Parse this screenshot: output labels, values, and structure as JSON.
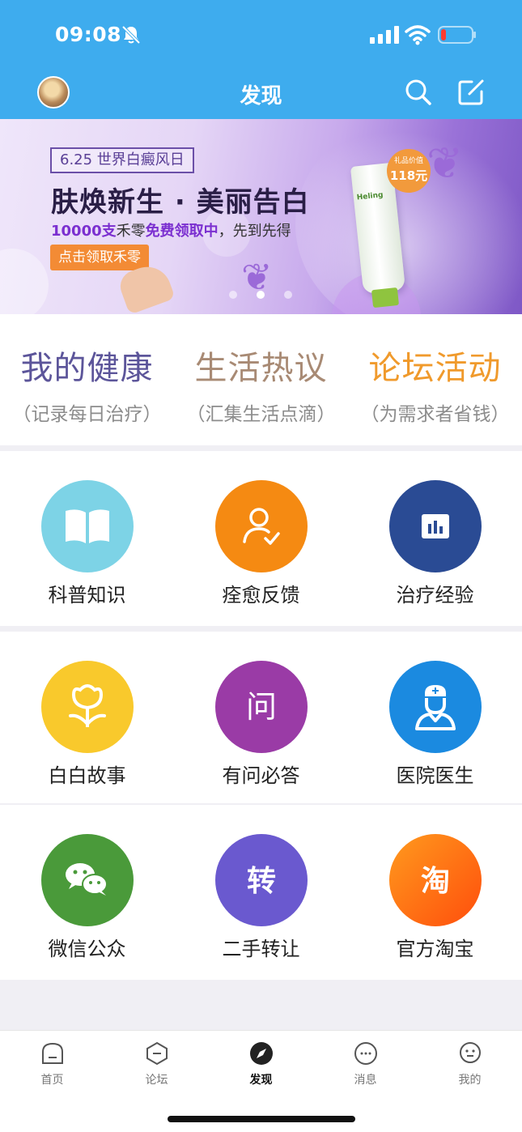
{
  "status_bar": {
    "time": "09:08",
    "icons": [
      "bell-mute-icon",
      "signal-icon",
      "wifi-icon",
      "battery-low-icon"
    ]
  },
  "header": {
    "title": "发现",
    "avatar": "user-avatar",
    "actions": [
      "search-icon",
      "edit-icon"
    ]
  },
  "banner": {
    "tag": "6.25 世界白癜风日",
    "headline": "肤焕新生 · 美丽告白",
    "subline_qty": "10000支",
    "subline_mid": "禾零",
    "subline_hl": "免费领取中",
    "subline_tail": "，先到先得",
    "cta": "点击领取禾零",
    "product_label": "Heling",
    "price_badge_top": "礼品价值",
    "price_badge_value": "118元",
    "carousel": {
      "count": 3,
      "active": 2
    }
  },
  "sections": [
    {
      "title": "我的健康",
      "desc": "（记录每日治疗）",
      "color": "#5c559a"
    },
    {
      "title": "生活热议",
      "desc": "（汇集生活点滴）",
      "color": "#a88a74"
    },
    {
      "title": "论坛活动",
      "desc": "（为需求者省钱）",
      "color": "#f09a2c"
    }
  ],
  "features": [
    [
      {
        "label": "科普知识",
        "icon": "book-icon",
        "color": "#7dd3e6"
      },
      {
        "label": "痊愈反馈",
        "icon": "user-check-icon",
        "color": "#f58a12"
      },
      {
        "label": "治疗经验",
        "icon": "chart-icon",
        "color": "#2a4b94"
      }
    ],
    [
      {
        "label": "白白故事",
        "icon": "flower-icon",
        "color": "#f9c92c"
      },
      {
        "label": "有问必答",
        "icon": "question-icon",
        "color": "#9a3ba6"
      },
      {
        "label": "医院医生",
        "icon": "doctor-icon",
        "color": "#1b8ae0"
      }
    ],
    [
      {
        "label": "微信公众",
        "icon": "wechat-icon",
        "color": "#4a9a3a"
      },
      {
        "label": "二手转让",
        "icon": "transfer-icon",
        "color": "#6a59cf"
      },
      {
        "label": "官方淘宝",
        "icon": "taobao-icon",
        "color": "#ff6a10"
      }
    ]
  ],
  "feature_glyphs": {
    "question": "问",
    "transfer": "转",
    "taobao": "淘"
  },
  "tabbar": [
    {
      "label": "首页",
      "icon": "home-icon",
      "active": false
    },
    {
      "label": "论坛",
      "icon": "forum-icon",
      "active": false
    },
    {
      "label": "发现",
      "icon": "compass-icon",
      "active": true
    },
    {
      "label": "消息",
      "icon": "message-icon",
      "active": false
    },
    {
      "label": "我的",
      "icon": "profile-icon",
      "active": false
    }
  ]
}
